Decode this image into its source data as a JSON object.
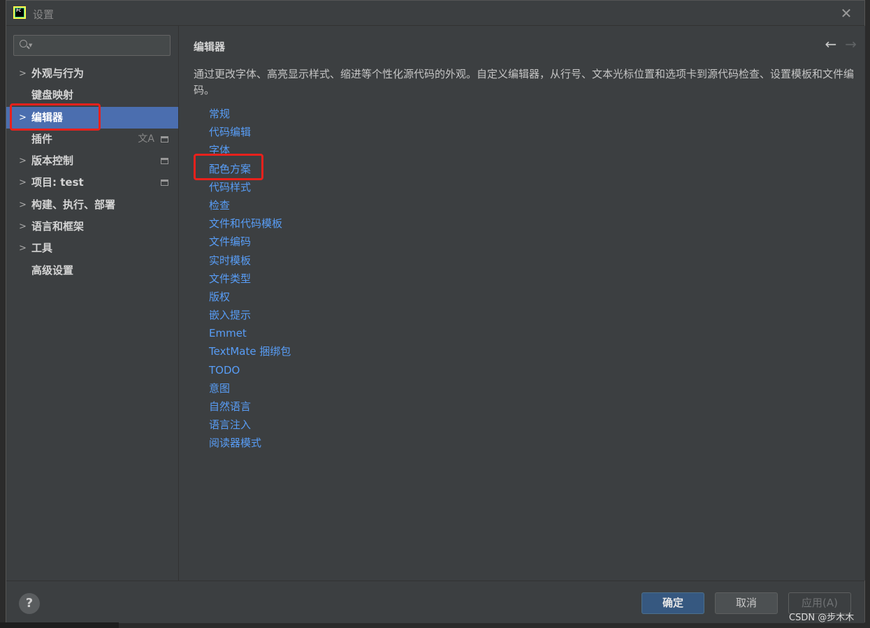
{
  "window": {
    "title": "设置",
    "app_icon_text": "PC"
  },
  "search": {
    "placeholder": ""
  },
  "sidebar": {
    "items": [
      {
        "label": "外观与行为",
        "expandable": true
      },
      {
        "label": "键盘映射",
        "expandable": false
      },
      {
        "label": "编辑器",
        "expandable": true,
        "selected": true
      },
      {
        "label": "插件",
        "expandable": false
      },
      {
        "label": "版本控制",
        "expandable": true
      },
      {
        "label": "项目: test",
        "expandable": true
      },
      {
        "label": "构建、执行、部署",
        "expandable": true
      },
      {
        "label": "语言和框架",
        "expandable": true
      },
      {
        "label": "工具",
        "expandable": true
      },
      {
        "label": "高级设置",
        "expandable": false
      }
    ]
  },
  "content": {
    "title": "编辑器",
    "description": "通过更改字体、高亮显示样式、缩进等个性化源代码的外观。自定义编辑器，从行号、文本光标位置和选项卡到源代码检查、设置模板和文件编码。",
    "links": [
      "常规",
      "代码编辑",
      "字体",
      "配色方案",
      "代码样式",
      "检查",
      "文件和代码模板",
      "文件编码",
      "实时模板",
      "文件类型",
      "版权",
      "嵌入提示",
      "Emmet",
      "TextMate 捆绑包",
      "TODO",
      "意图",
      "自然语言",
      "语言注入",
      "阅读器模式"
    ]
  },
  "footer": {
    "help": "?",
    "ok_label": "确定",
    "cancel_label": "取消",
    "apply_label": "应用(A)"
  },
  "watermark": "CSDN @步木木",
  "colors": {
    "accent": "#4b6eaf",
    "link": "#589df6",
    "highlight": "#e8211c"
  },
  "icons": {
    "close": "close-icon",
    "back": "arrow-left-icon",
    "forward": "arrow-right-icon"
  }
}
